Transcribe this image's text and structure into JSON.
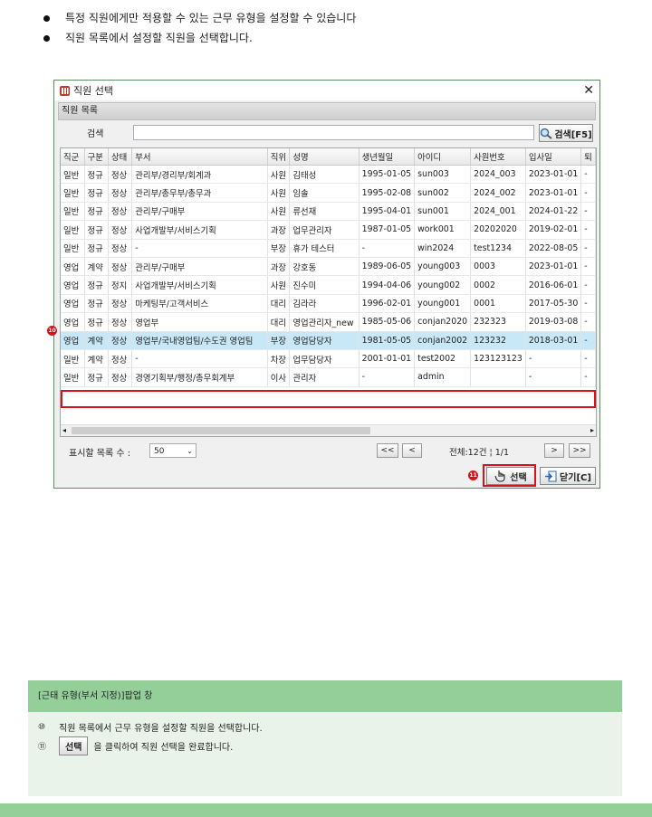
{
  "bullets": [
    "특정 직원에게만 적용할 수 있는 근무 유형을 설정할 수 있습니다",
    "직원 목록에서 설정할 직원을 선택합니다."
  ],
  "dialog": {
    "title": "직원 선택",
    "section": "직원 목록",
    "search_label": "검색",
    "search_value": "",
    "search_button": "검색[F5]",
    "columns": [
      "직군",
      "구분",
      "상태",
      "부서",
      "직위",
      "성명",
      "생년월일",
      "아이디",
      "사원번호",
      "입사일",
      "퇴"
    ],
    "rows": [
      [
        "일반",
        "정규",
        "정상",
        "관리부/경리부/회계과",
        "사원",
        "김태성",
        "1995-01-05",
        "sun003",
        "2024_003",
        "2023-01-01",
        "-"
      ],
      [
        "일반",
        "정규",
        "정상",
        "관리부/총무부/총무과",
        "사원",
        "임솔",
        "1995-02-08",
        "sun002",
        "2024_002",
        "2023-01-01",
        "-"
      ],
      [
        "일반",
        "정규",
        "정상",
        "관리부/구매부",
        "사원",
        "류선재",
        "1995-04-01",
        "sun001",
        "2024_001",
        "2024-01-22",
        "-"
      ],
      [
        "일반",
        "정규",
        "정상",
        "사업개발부/서비스기획",
        "과장",
        "업무관리자",
        "1987-01-05",
        "work001",
        "20202020",
        "2019-02-01",
        "-"
      ],
      [
        "일반",
        "정규",
        "정상",
        "-",
        "부장",
        "휴가 테스터",
        "-",
        "win2024",
        "test1234",
        "2022-08-05",
        "-"
      ],
      [
        "영업",
        "계약",
        "정상",
        "관리부/구매부",
        "과장",
        "강호동",
        "1989-06-05",
        "young003",
        "0003",
        "2023-01-01",
        "-"
      ],
      [
        "영업",
        "정규",
        "정지",
        "사업개발부/서비스기획",
        "사원",
        "진수미",
        "1994-04-06",
        "young002",
        "0002",
        "2016-06-01",
        "-"
      ],
      [
        "영업",
        "정규",
        "정상",
        "마케팅부/고객서비스",
        "대리",
        "김라라",
        "1996-02-01",
        "young001",
        "0001",
        "2017-05-30",
        "-"
      ],
      [
        "영업",
        "정규",
        "정상",
        "영업부",
        "대리",
        "영업관리자_new",
        "1985-05-06",
        "conjan2020",
        "232323",
        "2019-03-08",
        "-"
      ],
      [
        "영업",
        "계약",
        "정상",
        "영업부/국내영업팀/수도권 영업팀",
        "부장",
        "영업담당자",
        "1981-05-05",
        "conjan2002",
        "123232",
        "2018-03-01",
        "-"
      ],
      [
        "일반",
        "계약",
        "정상",
        "-",
        "차장",
        "업무담당자",
        "2001-01-01",
        "test2002",
        "123123123",
        "-",
        "-"
      ],
      [
        "일반",
        "정규",
        "정상",
        "경영기획부/행정/총무회계부",
        "이사",
        "관리자",
        "-",
        "admin",
        "",
        "-",
        "-"
      ]
    ],
    "selected_row": 9,
    "page_size_label": "표시할 목록 수 :",
    "page_size": "50",
    "prev_all": "<<",
    "prev": "<",
    "next": ">",
    "next_all": ">>",
    "total": "전체:12건 ¦ 1/1",
    "select_button": "선택",
    "close_button": "닫기[C]",
    "marker_10": "10",
    "marker_11": "11",
    "scroll_left": "◂",
    "scroll_right": "▸",
    "dropdown_arrow": "⌄"
  },
  "info": {
    "header": "[근태 유형(부서 지정)]팝업 창",
    "line1_num": "⑩",
    "line1": "직원 목록에서 근무 유형을 설정할 직원을 선택합니다.",
    "line2_num": "⑪",
    "line2_btn": "선택",
    "line2": "을 클릭하여 직원 선택을 완료합니다."
  },
  "colors": {
    "highlight": "#d8121b",
    "selected_row": "#c8e8f8",
    "info_green": "#94cf9a"
  },
  "icons": [
    "app-icon",
    "close-icon",
    "search-icon",
    "hand-pointer-icon",
    "close-dialog-icon"
  ]
}
